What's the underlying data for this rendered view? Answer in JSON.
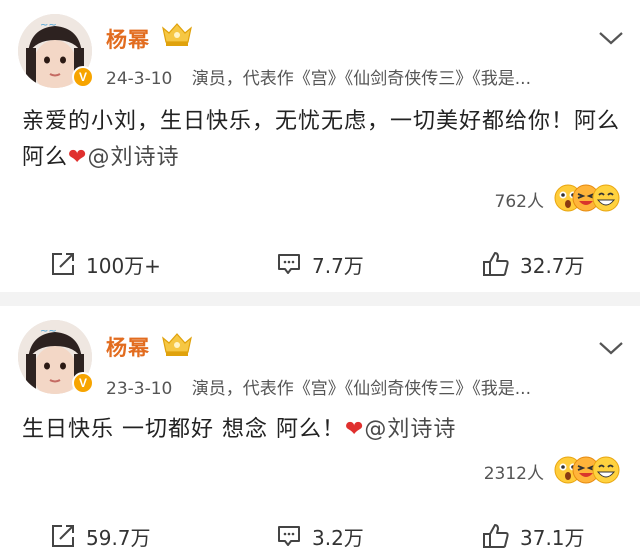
{
  "posts": [
    {
      "username": "杨幂",
      "date": "24-3-10",
      "bio": "演员，代表作《宫》《仙剑奇侠传三》《我是...",
      "text_main": "亲爱的小刘，生日快乐，无忧无虑，一切美好都给你！阿么阿么",
      "heart": "❤",
      "mention": "@刘诗诗",
      "reaction_count": "762人",
      "share_count": "100万+",
      "comment_count": "7.7万",
      "like_count": "32.7万"
    },
    {
      "username": "杨幂",
      "date": "23-3-10",
      "bio": "演员，代表作《宫》《仙剑奇侠传三》《我是...",
      "text_main": "生日快乐 一切都好 想念 阿么！",
      "heart": "❤",
      "mention": "@刘诗诗",
      "reaction_count": "2312人",
      "share_count": "59.7万",
      "comment_count": "3.2万",
      "like_count": "37.1万"
    }
  ],
  "icons": {
    "verified_badge": "V",
    "verified_color": "#f7a400",
    "username_color": "#e26c1f",
    "heart_color": "#e0302e"
  }
}
